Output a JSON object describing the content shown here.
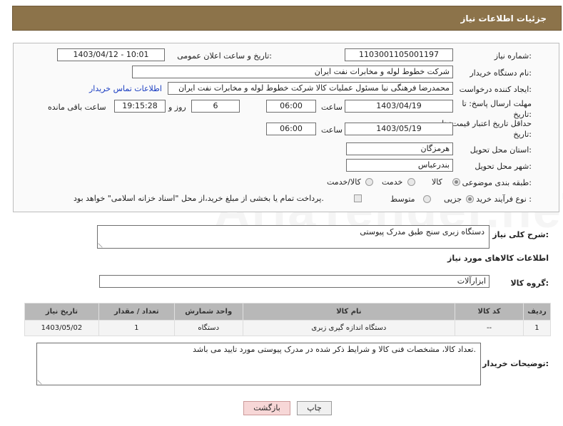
{
  "header": {
    "title": "جزئیات اطلاعات نیاز"
  },
  "watermark": "AriaTender.neT",
  "form": {
    "need_number_label": "شماره نیاز:",
    "need_number": "1103001105001197",
    "announce_label": "تاریخ و ساعت اعلان عمومی:",
    "announce_value": "1403/04/12 - 10:01",
    "buyer_label": "نام دستگاه خریدار:",
    "buyer_value": "شرکت خطوط لوله و مخابرات نفت ایران",
    "creator_label": "ایجاد کننده درخواست:",
    "creator_value": "محمدرضا فرهنگی نیا مسئول عملیات کالا شرکت خطوط لوله و مخابرات نفت ایران",
    "contact_link": "اطلاعات تماس خریدار",
    "reply_deadline_label": "مهلت ارسال پاسخ: تا تاریخ:",
    "reply_date": "1403/04/19",
    "time_label": "ساعت",
    "reply_time": "06:00",
    "days_value": "6",
    "days_label": "روز و",
    "remaining_time": "19:15:28",
    "remaining_label": "ساعت باقی مانده",
    "price_validity_label": "حداقل تاریخ اعتبار قیمت: تا تاریخ:",
    "price_date": "1403/05/19",
    "price_time": "06:00",
    "province_label": "استان محل تحویل:",
    "province_value": "هرمزگان",
    "city_label": "شهر محل تحویل:",
    "city_value": "بندرعباس",
    "category_label": "طبقه بندی موضوعی:",
    "category_options": [
      "کالا",
      "خدمت",
      "کالا/خدمت"
    ],
    "category_selected": "کالا",
    "process_label": "نوع فرآیند خرید :",
    "process_options": [
      "جزیی",
      "متوسط"
    ],
    "process_selected": "جزیی",
    "payment_note": "پرداخت تمام یا بخشی از مبلغ خرید،از محل \"اسناد خزانه اسلامی\" خواهد بود."
  },
  "description": {
    "label": "شرح کلی نیاز:",
    "value": "دستگاه زبری سنج طبق مدرک پیوستی"
  },
  "goods_section": {
    "title": "اطلاعات کالاهای مورد نیاز",
    "group_label": "گروه کالا:",
    "group_value": "ابزارآلات"
  },
  "table": {
    "headers": [
      "ردیف",
      "کد کالا",
      "نام کالا",
      "واحد شمارش",
      "تعداد / مقدار",
      "تاریخ نیاز"
    ],
    "rows": [
      [
        "1",
        "--",
        "دستگاه اندازه گیری زبری",
        "دستگاه",
        "1",
        "1403/05/02"
      ]
    ]
  },
  "buyer_notes": {
    "label": "توضیحات خریدار:",
    "value": "تعداد کالا، مشخصات فنی کالا و شرایط ذکر شده در مدرک پیوستی مورد تایید می باشد."
  },
  "buttons": {
    "print": "چاپ",
    "back": "بازگشت"
  }
}
